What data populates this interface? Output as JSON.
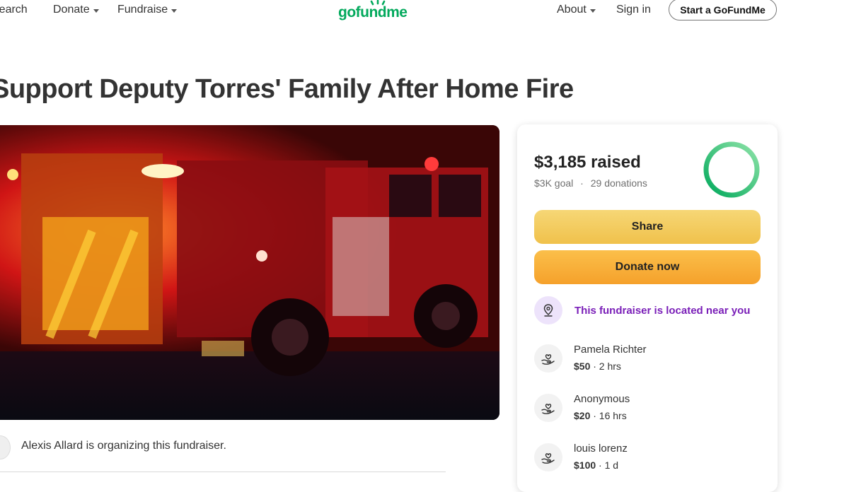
{
  "nav": {
    "search_label": "Search",
    "donate_label": "Donate",
    "fundraise_label": "Fundraise",
    "logo_text": "gofundme",
    "about_label": "About",
    "signin_label": "Sign in",
    "start_label": "Start a GoFundMe"
  },
  "campaign": {
    "title": "Support Deputy Torres' Family After Home Fire",
    "organizer_text": "Alexis Allard is organizing this fundraiser."
  },
  "donation_card": {
    "raised": "$3,185 raised",
    "goal": "$3K goal",
    "separator": "·",
    "donations": "29 donations",
    "progress_fraction": 1.0,
    "share_label": "Share",
    "donate_label": "Donate now",
    "near_text": "This fundraiser is located near you",
    "donors": [
      {
        "name": "Pamela Richter",
        "amount": "$50",
        "time": " · 2 hrs"
      },
      {
        "name": "Anonymous",
        "amount": "$20",
        "time": " · 16 hrs"
      },
      {
        "name": "louis lorenz",
        "amount": "$100",
        "time": " · 1 d"
      }
    ]
  },
  "colors": {
    "brand_green": "#02a95c",
    "share_yellow": "#f0c14b",
    "donate_orange": "#f5a12b",
    "near_purple": "#7a1fb8"
  },
  "icons": [
    "search-icon",
    "caret-down-icon",
    "location-pin-icon",
    "heart-hand-icon"
  ]
}
